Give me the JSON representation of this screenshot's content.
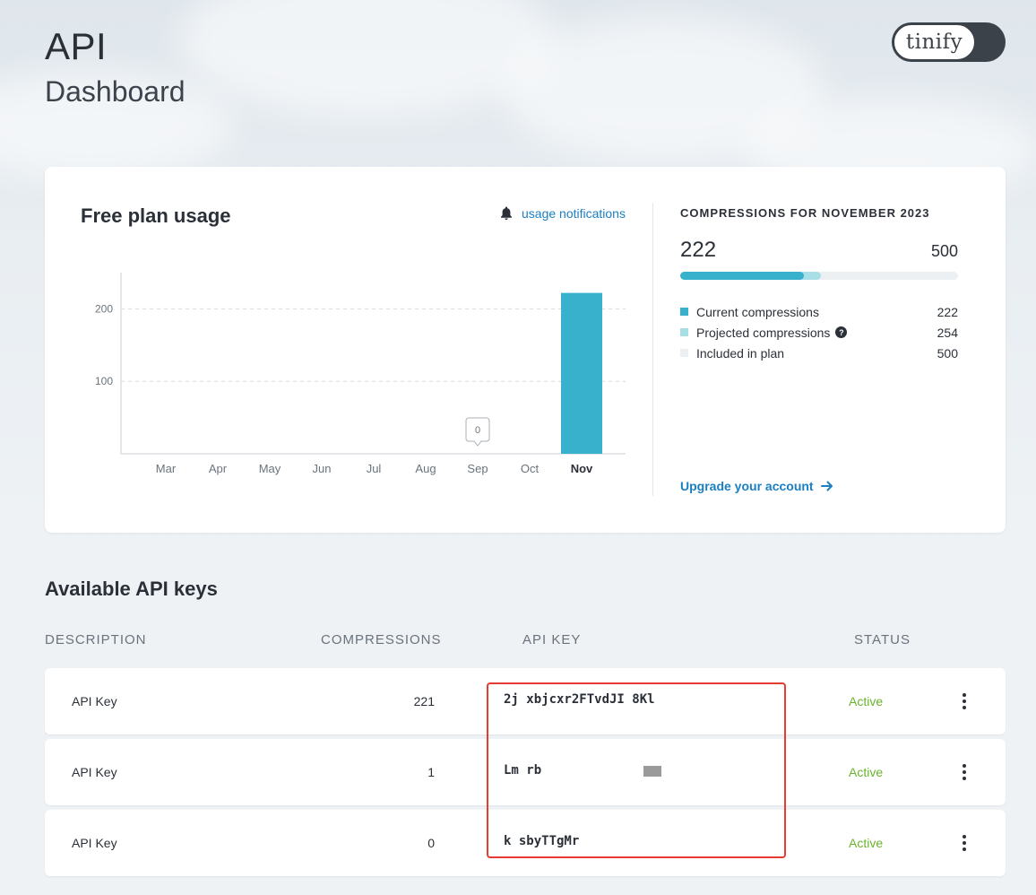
{
  "page": {
    "title": "API",
    "subtitle": "Dashboard",
    "logo_text": "tinify"
  },
  "usage": {
    "title": "Free plan usage",
    "notifications_label": "usage notifications",
    "stats_heading": "COMPRESSIONS FOR NOVEMBER 2023",
    "current": "222",
    "limit": "500",
    "current_fraction": 0.444,
    "projected_fraction": 0.508,
    "legend": [
      {
        "label": "Current compressions",
        "value": "222",
        "color": "#38b1cc"
      },
      {
        "label": "Projected compressions",
        "value": "254",
        "color": "#a8dfe6",
        "help": true
      },
      {
        "label": "Included in plan",
        "value": "500",
        "color": "#ecf0f2"
      }
    ],
    "upgrade_label": "Upgrade your account",
    "help_glyph": "?"
  },
  "chart_data": {
    "type": "bar",
    "categories": [
      "Mar",
      "Apr",
      "May",
      "Jun",
      "Jul",
      "Aug",
      "Sep",
      "Oct",
      "Nov"
    ],
    "values": [
      0,
      0,
      0,
      0,
      0,
      0,
      0,
      0,
      222
    ],
    "yticks": [
      100,
      200
    ],
    "ylim": [
      0,
      250
    ],
    "highlight_category": "Nov",
    "tooltip": {
      "category": "Sep",
      "text": "0"
    },
    "bar_color": "#38b1cc",
    "grid": "dashed horizontal"
  },
  "keys": {
    "title": "Available API keys",
    "headers": {
      "description": "DESCRIPTION",
      "compressions": "COMPRESSIONS",
      "api_key": "API KEY",
      "status": "STATUS"
    },
    "rows": [
      {
        "description": "API Key",
        "compressions": "221",
        "api_key": "2j                   xbjcxr2FTvdJI         8Kl",
        "status": "Active"
      },
      {
        "description": "API Key",
        "compressions": "1",
        "api_key": "Lm                                        rb",
        "status": "Active"
      },
      {
        "description": "API Key",
        "compressions": "0",
        "api_key": "k                                  sbyTTgMr",
        "status": "Active"
      }
    ]
  }
}
